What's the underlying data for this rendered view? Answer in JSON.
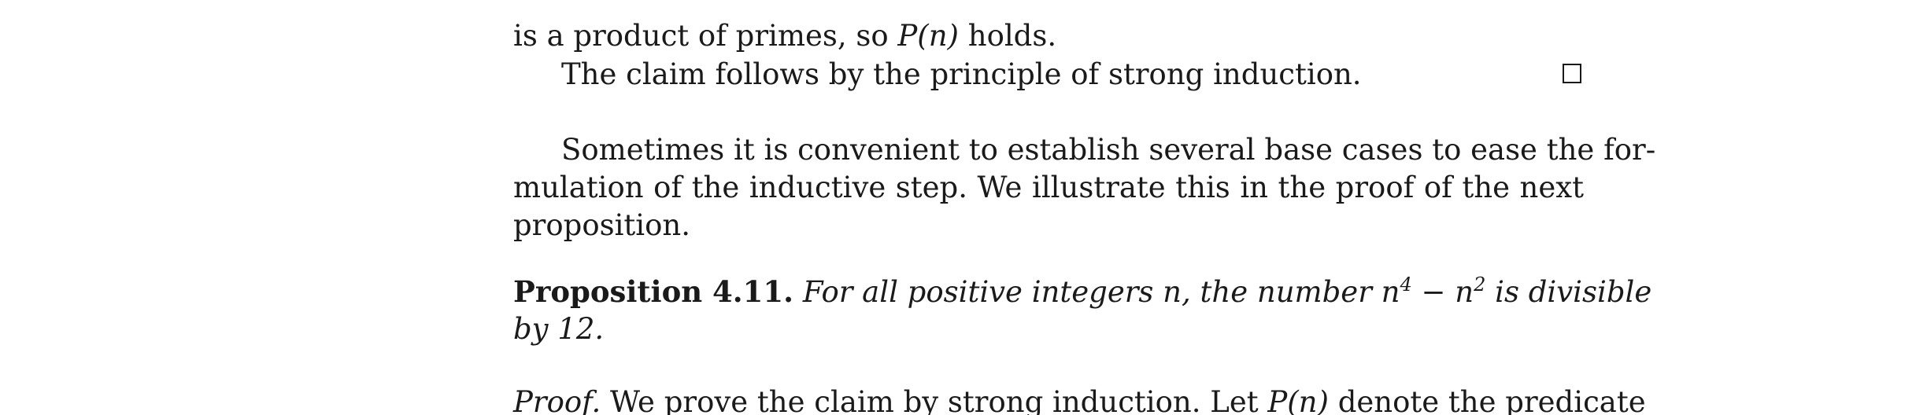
{
  "document": {
    "line1": {
      "prefix": "is a product of primes, so ",
      "math": "P(n)",
      "suffix": " holds."
    },
    "line2": "The claim follows by the principle of strong induction.",
    "paragraph": {
      "l1": "Sometimes it is convenient to establish several base cases to ease the for-",
      "l2": "mulation of the inductive step.  We illustrate this in the proof of the next",
      "l3": "proposition."
    },
    "proposition": {
      "label": "Proposition 4.11.",
      "l1_text": "For all positive integers n, the number n",
      "exp1": "4",
      "minus": " − n",
      "exp2": "2",
      "l1_tail": " is divisible",
      "l2": "by 12."
    },
    "proof": {
      "label": "Proof.",
      "text_a": " We prove the claim by strong induction.  Let ",
      "math": "P(n)",
      "text_b": " denote the predicate"
    }
  }
}
